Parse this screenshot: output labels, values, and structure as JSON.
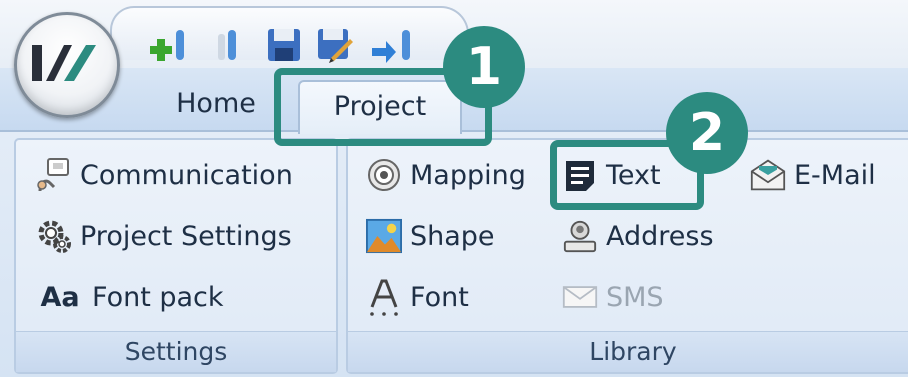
{
  "tabs": {
    "home": "Home",
    "project": "Project"
  },
  "quick_access": [
    "add-icon",
    "save-icon",
    "save-all-icon",
    "edit-icon",
    "download-icon"
  ],
  "settings_group": {
    "label": "Settings",
    "items": {
      "communication": "Communication",
      "project_settings": "Project Settings",
      "font_pack": "Font pack",
      "font_pack_icon": "Aa"
    }
  },
  "library_group": {
    "label": "Library",
    "items": {
      "mapping": "Mapping",
      "text": "Text",
      "email": "E-Mail",
      "shape": "Shape",
      "address": "Address",
      "font": "Font",
      "sms": "SMS"
    }
  },
  "callouts": {
    "one": "1",
    "two": "2"
  },
  "colors": {
    "callout": "#2c8b80",
    "ribbon": "#dfe9f6",
    "text": "#1e2f45",
    "disabled_text": "#9aa5b1"
  }
}
